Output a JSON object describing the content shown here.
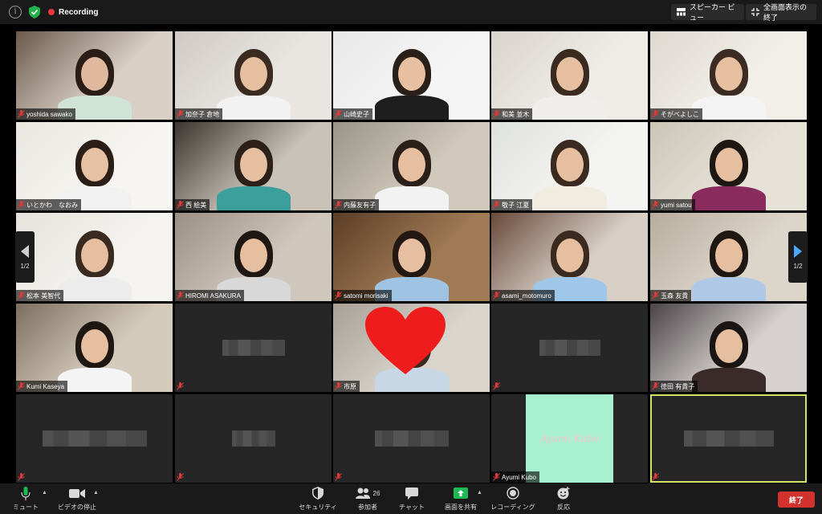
{
  "top_bar": {
    "recording_label": "Recording",
    "speaker_view_label": "スピーカー ビュー",
    "fullscreen_exit_label": "全画面表示の終了",
    "recording_color": "#e8383b",
    "shield_color": "#23b24a"
  },
  "navigation": {
    "page_left": "1/2",
    "page_right": "1/2",
    "arrow_color": "#4aa8ff"
  },
  "participants": [
    {
      "name": "yoshida sawako",
      "video": true
    },
    {
      "name": "加奈子 倉地",
      "video": true
    },
    {
      "name": "山崎史子",
      "video": true
    },
    {
      "name": "和美 並木",
      "video": true
    },
    {
      "name": "そがべよしこ",
      "video": true
    },
    {
      "name": "いとかわ　なおみ",
      "video": true
    },
    {
      "name": "西 絵美",
      "video": true
    },
    {
      "name": "内藤友有子",
      "video": true
    },
    {
      "name": "敬子 江夏",
      "video": true
    },
    {
      "name": "yumi satou",
      "video": true
    },
    {
      "name": "松本 美智代",
      "video": true
    },
    {
      "name": "HIROMI ASAKURA",
      "video": true
    },
    {
      "name": "satomi morisaki",
      "video": true
    },
    {
      "name": "asami_motomuro",
      "video": true
    },
    {
      "name": "玉森 友貴",
      "video": true
    },
    {
      "name": "Kumi Kaseya",
      "video": true
    },
    {
      "name": "",
      "video": false
    },
    {
      "name": "市原",
      "video": true
    },
    {
      "name": "",
      "video": false
    },
    {
      "name": "徳田 有貴子",
      "video": true
    },
    {
      "name": "",
      "video": false
    },
    {
      "name": "",
      "video": false
    },
    {
      "name": "",
      "video": false
    },
    {
      "name": "Ayumi Kubo",
      "video": true,
      "card_text": "Ayumi Kubo",
      "card_color": "#a8f0cf"
    },
    {
      "name": "",
      "video": false,
      "active_speaker": true
    }
  ],
  "bottom_bar": {
    "mute_label": "ミュート",
    "stop_video_label": "ビデオの停止",
    "security_label": "セキュリティ",
    "participants_label": "参加者",
    "participants_count": "26",
    "chat_label": "チャット",
    "share_label": "画面を共有",
    "recording_label": "レコーディング",
    "reactions_label": "反応",
    "end_label": "終了",
    "share_color": "#1db954",
    "mic_color": "#1db954"
  }
}
